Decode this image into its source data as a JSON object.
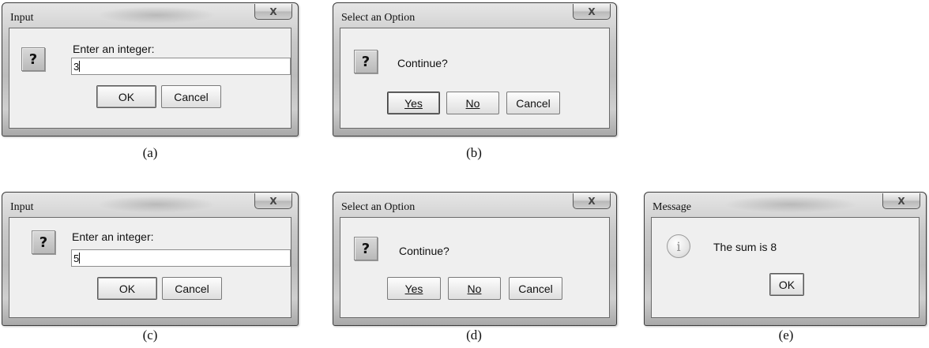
{
  "dialogs": {
    "a": {
      "title": "Input",
      "message": "Enter an integer:",
      "input_value": "3",
      "ok_label": "OK",
      "cancel_label": "Cancel",
      "caption": "(a)"
    },
    "b": {
      "title": "Select an Option",
      "message": "Continue?",
      "yes_label": "Yes",
      "no_label": "No",
      "cancel_label": "Cancel",
      "caption": "(b)"
    },
    "c": {
      "title": "Input",
      "message": "Enter an integer:",
      "input_value": "5",
      "ok_label": "OK",
      "cancel_label": "Cancel",
      "caption": "(c)"
    },
    "d": {
      "title": "Select an Option",
      "message": "Continue?",
      "yes_label": "Yes",
      "no_label": "No",
      "cancel_label": "Cancel",
      "caption": "(d)"
    },
    "e": {
      "title": "Message",
      "message": "The sum is 8",
      "ok_label": "OK",
      "caption": "(e)"
    }
  },
  "icons": {
    "close": "close-icon",
    "question": "question-icon",
    "information": "information-icon"
  },
  "close_glyph": "X",
  "question_glyph": "?",
  "info_glyph": "i"
}
